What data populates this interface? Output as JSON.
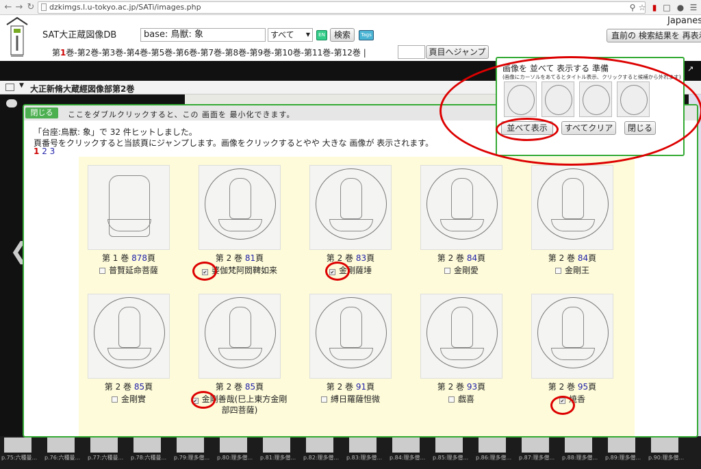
{
  "browser": {
    "url": "dzkimgs.l.u-tokyo.ac.jp/SATi/images.php",
    "back_icon": "arrow-left",
    "forward_icon": "arrow-right",
    "reload_icon": "reload"
  },
  "header": {
    "site_title": "SAT大正蔵図像DB",
    "search_value": "base: 鳥獣: 象",
    "scope_value": "すべて",
    "en_label": "EN",
    "search_label": "検索",
    "tags_label": "Tags",
    "language": "Japanese",
    "back_results_label": "直前の 検索結果を 再表示",
    "volumes_prefix": "第",
    "volumes_current": "1",
    "volumes_rest": "巻-第2巻-第3巻-第4巻-第5巻-第6巻-第7巻-第8巻-第9巻-第10巻-第11巻-第12巻 |",
    "jump_label": "頁目へジャンプ"
  },
  "viewer": {
    "title": "大正新脩大蔵經図像部第2巻"
  },
  "panel": {
    "close_label": "閉じる",
    "minimize_hint": "ここをダブルクリックすると、この 画面を 最小化できます。",
    "hits_text": "「台座:鳥獣: 象」で 32 件ヒットしました。",
    "help_text": "頁番号をクリックすると当該頁にジャンプします。画像をクリックするとやや 大きな 画像が 表示されます。",
    "pages": [
      "1",
      "2",
      "3"
    ],
    "items": [
      {
        "vol": "第 1 巻",
        "page": "878",
        "suffix": "頁",
        "name": "普賢延命菩薩",
        "checked": false,
        "shape": "rect"
      },
      {
        "vol": "第 2 巻",
        "page": "81",
        "suffix": "頁",
        "name": "婆伽梵阿閦鞞如来",
        "checked": true,
        "shape": "circle"
      },
      {
        "vol": "第 2 巻",
        "page": "83",
        "suffix": "頁",
        "name": "金剛薩埵",
        "checked": true,
        "shape": "circle"
      },
      {
        "vol": "第 2 巻",
        "page": "84",
        "suffix": "頁",
        "name": "金剛愛",
        "checked": false,
        "shape": "circle"
      },
      {
        "vol": "第 2 巻",
        "page": "84",
        "suffix": "頁",
        "name": "金剛王",
        "checked": false,
        "shape": "circle"
      },
      {
        "vol": "第 2 巻",
        "page": "85",
        "suffix": "頁",
        "name": "金剛實",
        "checked": false,
        "shape": "circle"
      },
      {
        "vol": "第 2 巻",
        "page": "85",
        "suffix": "頁",
        "name": "金剛善哉(巳上東方金剛部四菩薩)",
        "checked": true,
        "shape": "circle"
      },
      {
        "vol": "第 2 巻",
        "page": "91",
        "suffix": "頁",
        "name": "縛日羅薩怛微",
        "checked": false,
        "shape": "circle"
      },
      {
        "vol": "第 2 巻",
        "page": "93",
        "suffix": "頁",
        "name": "戯喜",
        "checked": false,
        "shape": "circle"
      },
      {
        "vol": "第 2 巻",
        "page": "95",
        "suffix": "頁",
        "name": "焼香",
        "checked": true,
        "shape": "circle"
      }
    ]
  },
  "prepare": {
    "title": "画像を 並べて 表示する 準備",
    "note": "(画像にカーソルをあてるとタイトル表示、クリックすると候補から外れます)",
    "show_label": "並べて表示",
    "clear_label": "すべてクリア",
    "close_label": "閉じる",
    "thumb_count": 4
  },
  "strip": {
    "labels": [
      "p.75:六種曼...",
      "p.76:六種曼...",
      "p.77:六種曼...",
      "p.78:六種曼...",
      "p.79:理多僧...",
      "p.80:理多僧...",
      "p.81:理多僧...",
      "p.82:理多僧...",
      "p.83:理多僧...",
      "p.84:理多僧...",
      "p.85:理多僧...",
      "p.86:理多僧...",
      "p.87:理多僧...",
      "p.88:理多僧...",
      "p.89:理多僧...",
      "p.90:理多僧..."
    ]
  },
  "colors": {
    "accent_green": "#33aa33",
    "annotation_red": "#dd0000",
    "grid_bg": "#fdfbd9"
  }
}
